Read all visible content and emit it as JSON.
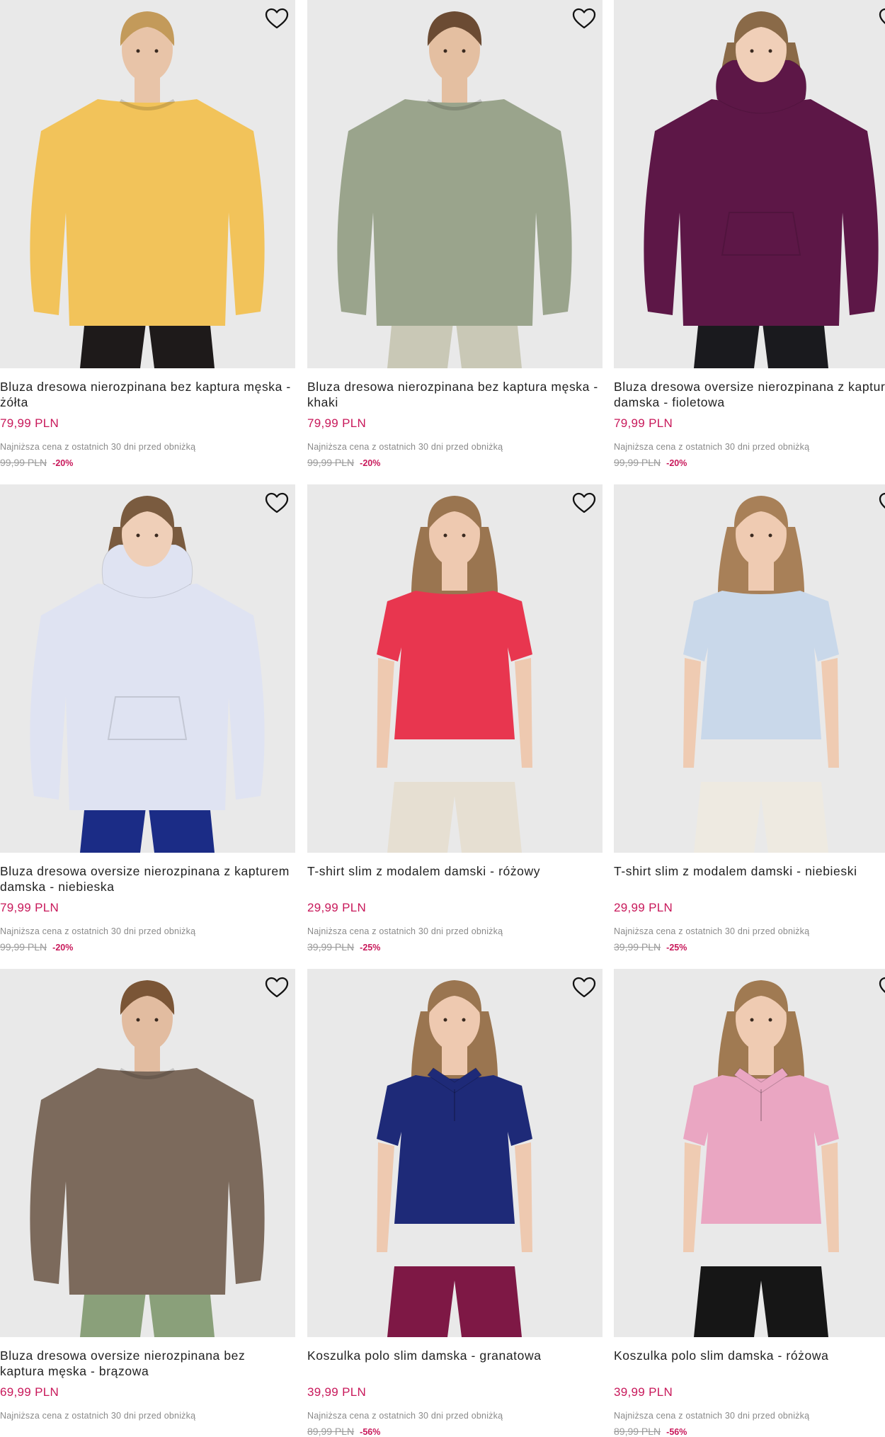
{
  "colors": {
    "price": "#c8185a",
    "discount": "#c8185a",
    "muted": "#8a8a8a",
    "photo_bg": "#e9e9e9"
  },
  "icons": {
    "favorite": "heart-outline-icon"
  },
  "products": [
    {
      "title": "Bluza dresowa nierozpinana bez kaptura męska - żółta",
      "price": "79,99 PLN",
      "lowest_note": "Najniższa cena z ostatnich 30 dni przed obniżką",
      "old_price": "99,99 PLN",
      "discount": "-20%",
      "garment_color": "#f2c35a",
      "garment": "sweatshirt",
      "pants_color": "#1e1a1a",
      "hair": "#c39a5a",
      "skin": "#e8c4a8"
    },
    {
      "title": "Bluza dresowa nierozpinana bez kaptura męska - khaki",
      "price": "79,99 PLN",
      "lowest_note": "Najniższa cena z ostatnich 30 dni przed obniżką",
      "old_price": "99,99 PLN",
      "discount": "-20%",
      "garment_color": "#9aa48c",
      "garment": "sweatshirt",
      "pants_color": "#c9c8b6",
      "hair": "#6b4b33",
      "skin": "#e4bfa1"
    },
    {
      "title": "Bluza dresowa oversize nierozpinana z kapturem damska - fioletowa",
      "price": "79,99 PLN",
      "lowest_note": "Najniższa cena z ostatnich 30 dni przed obniżką",
      "old_price": "99,99 PLN",
      "discount": "-20%",
      "garment_color": "#5d1747",
      "garment": "hoodie",
      "pants_color": "#1a1a1e",
      "hair": "#8a6a48",
      "skin": "#f0cfb8"
    },
    {
      "title": "Bluza dresowa oversize nierozpinana z kapturem damska - niebieska",
      "price": "79,99 PLN",
      "lowest_note": "Najniższa cena z ostatnich 30 dni przed obniżką",
      "old_price": "99,99 PLN",
      "discount": "-20%",
      "garment_color": "#dfe3f2",
      "garment": "hoodie",
      "pants_color": "#1b2c86",
      "hair": "#7a5b3f",
      "skin": "#efcfb8"
    },
    {
      "title": "T-shirt slim z modalem damski - różowy",
      "price": "29,99 PLN",
      "lowest_note": "Najniższa cena z ostatnich 30 dni przed obniżką",
      "old_price": "39,99 PLN",
      "discount": "-25%",
      "garment_color": "#e8364f",
      "garment": "tshirt",
      "pants_color": "#e6dfd2",
      "hair": "#9a7550",
      "skin": "#eec9b0"
    },
    {
      "title": "T-shirt slim z modalem damski - niebieski",
      "price": "29,99 PLN",
      "lowest_note": "Najniższa cena z ostatnich 30 dni przed obniżką",
      "old_price": "39,99 PLN",
      "discount": "-25%",
      "garment_color": "#c9d8ea",
      "garment": "tshirt",
      "pants_color": "#eeeae1",
      "hair": "#a88058",
      "skin": "#efcbb2"
    },
    {
      "title": "Bluza dresowa oversize nierozpinana bez kaptura męska - brązowa",
      "price": "69,99 PLN",
      "lowest_note": "Najniższa cena z ostatnich 30 dni przed obniżką",
      "old_price": "",
      "discount": "",
      "garment_color": "#7c6a5c",
      "garment": "sweatshirt",
      "pants_color": "#8aa07a",
      "hair": "#7a5536",
      "skin": "#e2bca0"
    },
    {
      "title": "Koszulka polo slim damska - granatowa",
      "price": "39,99 PLN",
      "lowest_note": "Najniższa cena z ostatnich 30 dni przed obniżką",
      "old_price": "89,99 PLN",
      "discount": "-56%",
      "garment_color": "#1e2a78",
      "garment": "polo",
      "pants_color": "#7e1845",
      "hair": "#9a7550",
      "skin": "#eec9b0"
    },
    {
      "title": "Koszulka polo slim damska - różowa",
      "price": "39,99 PLN",
      "lowest_note": "Najniższa cena z ostatnich 30 dni przed obniżką",
      "old_price": "89,99 PLN",
      "discount": "-56%",
      "garment_color": "#eaa6c2",
      "garment": "polo",
      "pants_color": "#161616",
      "hair": "#a07a52",
      "skin": "#efcbb2"
    }
  ]
}
